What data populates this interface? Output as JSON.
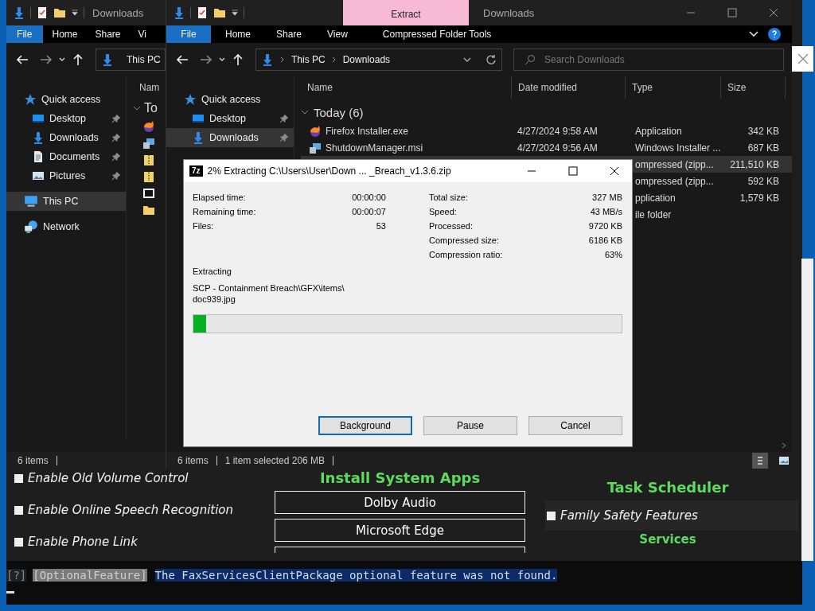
{
  "background_app": {
    "options": [
      {
        "label": "Enable Old Volume Control",
        "checked": false
      },
      {
        "label": "Enable Online Speech Recognition",
        "checked": false
      },
      {
        "label": "Enable Phone Link",
        "checked": false
      }
    ],
    "install_heading": "Install System Apps",
    "install_buttons": [
      "Dolby Audio",
      "Microsoft Edge"
    ],
    "task_heading": "Task Scheduler",
    "task_options": [
      {
        "label": "Family Safety Features",
        "checked": false
      }
    ],
    "services_heading": "Services"
  },
  "terminal": {
    "tag": "[?]",
    "category": "[OptionalFeature]",
    "message": "The FaxServicesClientPackage optional feature was not found."
  },
  "explorer_back": {
    "title": "Downloads",
    "ribbon_tabs": [
      {
        "label": "File",
        "selected": true
      },
      {
        "label": "Home",
        "selected": false
      },
      {
        "label": "Share",
        "selected": false
      },
      {
        "label": "Vi",
        "selected": false
      }
    ],
    "address": [
      "This PC"
    ],
    "sidebar": [
      {
        "label": "Quick access",
        "kind": "star",
        "pinned": false,
        "selected": false,
        "sub": false
      },
      {
        "label": "Desktop",
        "kind": "desktop",
        "pinned": true,
        "selected": false,
        "sub": true
      },
      {
        "label": "Downloads",
        "kind": "download",
        "pinned": true,
        "selected": false,
        "sub": true
      },
      {
        "label": "Documents",
        "kind": "document",
        "pinned": true,
        "selected": false,
        "sub": true
      },
      {
        "label": "Pictures",
        "kind": "picture",
        "pinned": true,
        "selected": false,
        "sub": true
      },
      {
        "label": "This PC",
        "kind": "pc",
        "pinned": false,
        "selected": true,
        "sub": false
      },
      {
        "label": "Network",
        "kind": "network",
        "pinned": false,
        "selected": false,
        "sub": false
      }
    ],
    "column": "Nam",
    "group": "To",
    "files": [
      {
        "kind": "app"
      },
      {
        "kind": "installer"
      },
      {
        "kind": "zip"
      },
      {
        "kind": "zip"
      },
      {
        "kind": "archive"
      },
      {
        "kind": "folder"
      }
    ],
    "status": "6 items"
  },
  "explorer_front": {
    "title": "Downloads",
    "context_tab": "Extract",
    "ribbon_tabs": [
      {
        "label": "File",
        "selected": true
      },
      {
        "label": "Home",
        "selected": false
      },
      {
        "label": "Share",
        "selected": false
      },
      {
        "label": "View",
        "selected": false
      },
      {
        "label": "Compressed Folder Tools",
        "selected": false
      }
    ],
    "address": [
      "This PC",
      "Downloads"
    ],
    "search": {
      "placeholder": "Search Downloads"
    },
    "sidebar": [
      {
        "label": "Quick access",
        "kind": "star",
        "pinned": false,
        "selected": false,
        "sub": false
      },
      {
        "label": "Desktop",
        "kind": "desktop",
        "pinned": true,
        "selected": false,
        "sub": true
      },
      {
        "label": "Downloads",
        "kind": "download",
        "pinned": true,
        "selected": true,
        "sub": true
      }
    ],
    "columns": [
      "Name",
      "Date modified",
      "Type",
      "Size"
    ],
    "group": "Today (6)",
    "rows": [
      {
        "kind": "app",
        "name": "Firefox Installer.exe",
        "date": "4/27/2024 9:58 AM",
        "type": "Application",
        "size": "342 KB",
        "selected": false
      },
      {
        "kind": "installer",
        "name": "ShutdownManager.msi",
        "date": "4/27/2024 9:56 AM",
        "type": "Windows Installer ...",
        "size": "687 KB",
        "selected": false
      },
      {
        "type": "ompressed (zipp...",
        "size": "211,510 KB",
        "selected": true
      },
      {
        "type": "ompressed (zipp...",
        "size": "592 KB",
        "selected": false
      },
      {
        "type": "pplication",
        "size": "1,579 KB",
        "selected": false
      },
      {
        "type": "ile folder",
        "selected": false
      }
    ],
    "status": {
      "count": "6 items",
      "selection": "1 item selected  206 MB"
    }
  },
  "dialog": {
    "icon_label": "7z",
    "title": "2% Extracting C:\\Users\\User\\Down ... _Breach_v1.3.6.zip",
    "left_stats": [
      {
        "label": "Elapsed time:",
        "value": "00:00:00"
      },
      {
        "label": "Remaining time:",
        "value": "00:00:07"
      },
      {
        "label": "Files:",
        "value": "53"
      }
    ],
    "right_stats": [
      {
        "label": "Total size:",
        "value": "327 MB"
      },
      {
        "label": "Speed:",
        "value": "43 MB/s"
      },
      {
        "label": "Processed:",
        "value": "9720 KB"
      },
      {
        "label": "Compressed size:",
        "value": "6186 KB"
      },
      {
        "label": "Compression ratio:",
        "value": "63%"
      }
    ],
    "status": "Extracting",
    "path_lines": [
      "SCP - Containment Breach\\GFX\\items\\",
      "doc939.jpg"
    ],
    "progress": {
      "level": 0.03
    },
    "buttons": [
      {
        "label": "Background",
        "default": true
      },
      {
        "label": "Pause",
        "default": false
      },
      {
        "label": "Cancel",
        "default": false
      }
    ]
  }
}
